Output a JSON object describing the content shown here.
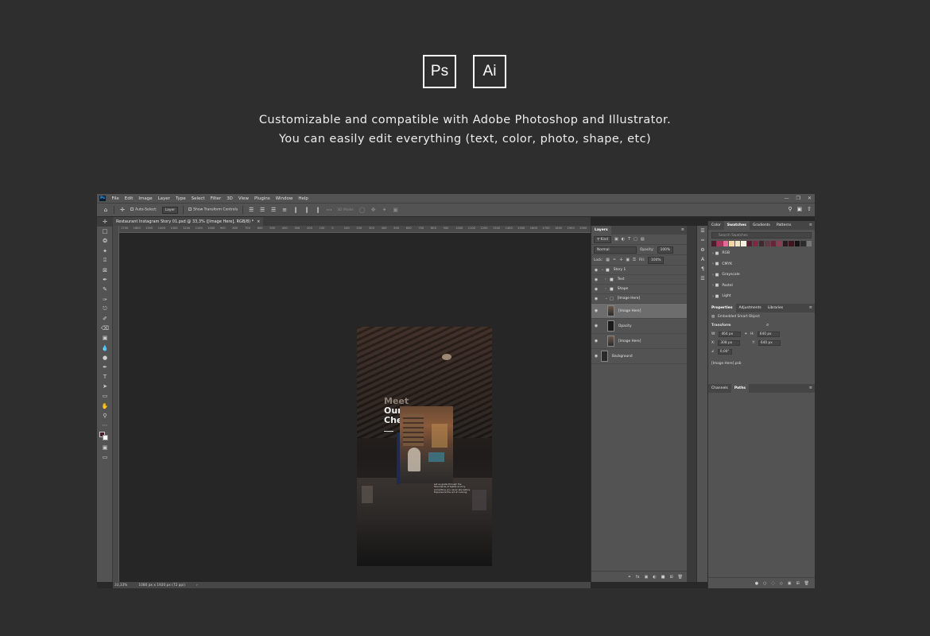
{
  "hero": {
    "ps_label": "Ps",
    "ai_label": "Ai",
    "line1": "Customizable and compatible with Adobe Photoshop and Illustrator.",
    "line2": "You can easily edit everything (text, color, photo, shape, etc)"
  },
  "menu": [
    "File",
    "Edit",
    "Image",
    "Layer",
    "Type",
    "Select",
    "Filter",
    "3D",
    "View",
    "Plugins",
    "Window",
    "Help"
  ],
  "options": {
    "auto_select": "Auto-Select:",
    "auto_select_value": "Layer",
    "show_transform": "Show Transform Controls",
    "mode_3d": "3D Mode:"
  },
  "document": {
    "tab_title": "Restaurant Instagram Story 01.psd @ 33,3% ([Image Here], RGB/8) *",
    "zoom": "33,33%",
    "size": "1080 px x 1920 px (72 ppi)",
    "ruler": [
      "1700",
      "1600",
      "1500",
      "1400",
      "1300",
      "1200",
      "1100",
      "1000",
      "900",
      "800",
      "700",
      "600",
      "500",
      "400",
      "300",
      "200",
      "100",
      "0",
      "100",
      "200",
      "300",
      "400",
      "500",
      "600",
      "700",
      "800",
      "900",
      "1000",
      "1100",
      "1200",
      "1300",
      "1400",
      "1500",
      "1600",
      "1700",
      "1800",
      "1900",
      "2000"
    ]
  },
  "artwork": {
    "meet": "Meet",
    "our": "Our",
    "chefs": "Chefs",
    "desc": "Let us guide through the flavorlands of tastes and try something you never ate before. Experience the art of cooking."
  },
  "layers_panel": {
    "tab": "Layers",
    "kind": "Kind",
    "blend": "Normal",
    "opacity_label": "Opacity:",
    "opacity": "100%",
    "lock_label": "Lock:",
    "fill_label": "Fill:",
    "fill": "100%",
    "items": [
      {
        "name": "Story 1",
        "type": "group"
      },
      {
        "name": "Text",
        "type": "group"
      },
      {
        "name": "Shape",
        "type": "group"
      },
      {
        "name": "[Image Here]",
        "type": "group"
      },
      {
        "name": "[Image Here]",
        "type": "smart"
      },
      {
        "name": "Opacity",
        "type": "layer"
      },
      {
        "name": "[Image Here]",
        "type": "smart"
      },
      {
        "name": "Background",
        "type": "layer"
      }
    ]
  },
  "swatches_panel": {
    "tabs": [
      "Color",
      "Swatches",
      "Gradients",
      "Patterns"
    ],
    "search_placeholder": "Search Swatches",
    "colors": [
      "#4a1e2c",
      "#a9335a",
      "#e36b94",
      "#f4d6a5",
      "#efe3c2",
      "#f6f0e2",
      "#5b1d31",
      "#7d2941",
      "#3c2a2e",
      "#5e3a45",
      "#6e2237",
      "#8b3c52",
      "#2b1b20",
      "#401521",
      "#181214",
      "#2c2c2c",
      "#767676"
    ],
    "groups": [
      "RGB",
      "CMYK",
      "Grayscale",
      "Pastel",
      "Light"
    ]
  },
  "properties_panel": {
    "tabs": [
      "Properties",
      "Adjustments",
      "Libraries"
    ],
    "type": "Embedded Smart Object",
    "transform": "Transform",
    "w_label": "W:",
    "w": "464 px",
    "h_label": "H:",
    "h": "640 px",
    "x_label": "X:",
    "x": "308 px",
    "y_label": "Y:",
    "y": "640 px",
    "angle": "0,00°",
    "file": "[Image Here].psb"
  },
  "paths_panel": {
    "tabs": [
      "Channels",
      "Paths"
    ]
  }
}
